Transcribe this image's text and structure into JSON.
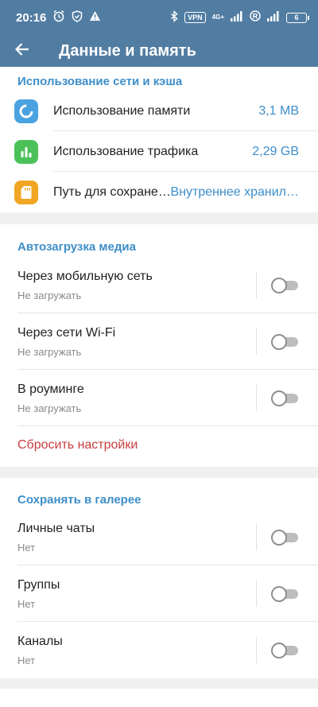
{
  "status_bar": {
    "time": "20:16",
    "vpn": "VPN",
    "network": "4G+",
    "battery": "6",
    "icons": [
      "alarm-icon",
      "shield-icon",
      "warning-icon",
      "bluetooth-icon",
      "signal-icon",
      "roaming-icon",
      "signal-icon",
      "battery-icon"
    ]
  },
  "app_bar": {
    "title": "Данные и память",
    "back_icon": "arrow-left-icon"
  },
  "network_usage": {
    "header": "Использование сети и кэша",
    "items": [
      {
        "label": "Использование памяти",
        "value": "3,1 MB",
        "icon": "storage-pie-icon",
        "color": "#4aa3e0"
      },
      {
        "label": "Использование трафика",
        "value": "2,29 GB",
        "icon": "bar-chart-icon",
        "color": "#4cc15a"
      },
      {
        "label": "Путь для сохране…",
        "value": "Внутреннее хранил…",
        "icon": "sd-card-icon",
        "color": "#f0a623"
      }
    ]
  },
  "media_autodownload": {
    "header": "Автозагрузка медиа",
    "items": [
      {
        "label": "Через мобильную сеть",
        "sub": "Не загружать",
        "enabled": false
      },
      {
        "label": "Через сети Wi-Fi",
        "sub": "Не загружать",
        "enabled": false
      },
      {
        "label": "В роуминге",
        "sub": "Не загружать",
        "enabled": false
      }
    ],
    "reset_label": "Сбросить настройки"
  },
  "save_to_gallery": {
    "header": "Сохранять в галерее",
    "items": [
      {
        "label": "Личные чаты",
        "sub": "Нет",
        "enabled": false
      },
      {
        "label": "Группы",
        "sub": "Нет",
        "enabled": false
      },
      {
        "label": "Каналы",
        "sub": "Нет",
        "enabled": false
      }
    ]
  },
  "colors": {
    "accent": "#527da3",
    "header_text": "#3d8ec9",
    "danger": "#c73d3d"
  }
}
